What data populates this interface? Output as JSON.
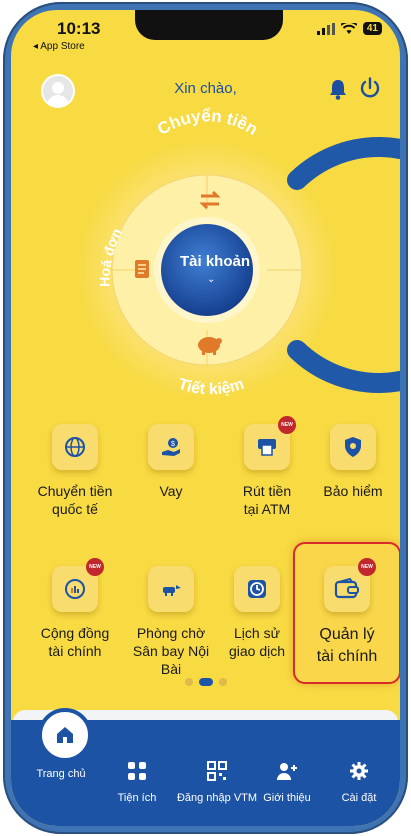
{
  "status": {
    "time": "10:13",
    "back_app": "◂ App Store",
    "battery": "41"
  },
  "header": {
    "greeting": "Xin chào,"
  },
  "wheel": {
    "top_label": "Chuyển tiền",
    "left_label": "Hoá đơn",
    "bottom_label": "Tiết kiệm",
    "center_label": "Tài khoản",
    "center_chevron": "⌄"
  },
  "services": [
    {
      "label_1": "Chuyển tiền",
      "label_2": "quốc tế",
      "icon": "globe-icon",
      "new": false
    },
    {
      "label_1": "Vay",
      "label_2": "",
      "icon": "loan-hand-icon",
      "new": false
    },
    {
      "label_1": "Rút tiền",
      "label_2": "tại ATM",
      "icon": "atm-icon",
      "new": true
    },
    {
      "label_1": "Bảo hiểm",
      "label_2": "",
      "icon": "shield-icon",
      "new": false
    },
    {
      "label_1": "Cộng đồng",
      "label_2": "tài chính",
      "icon": "community-icon",
      "new": true
    },
    {
      "label_1": "Phòng chờ",
      "label_2": "Sân bay Nội",
      "label_3": "Bài",
      "icon": "airport-lounge-icon",
      "new": false
    },
    {
      "label_1": "Lịch sử",
      "label_2": "giao dịch",
      "icon": "clock-icon",
      "new": false
    },
    {
      "label_1": "Quản lý",
      "label_2": "tài chính",
      "icon": "wallet-icon",
      "new": true
    }
  ],
  "new_badge": "NEW",
  "nav": {
    "home": "Trang chủ",
    "utilities": "Tiện ích",
    "vtm": "Đăng nhập VTM",
    "referral": "Giới thiệu",
    "settings": "Cài đặt"
  },
  "colors": {
    "background": "#f8da43",
    "primary": "#1d53a5",
    "badge": "#c0282d",
    "highlight_border": "#d72a2a"
  }
}
